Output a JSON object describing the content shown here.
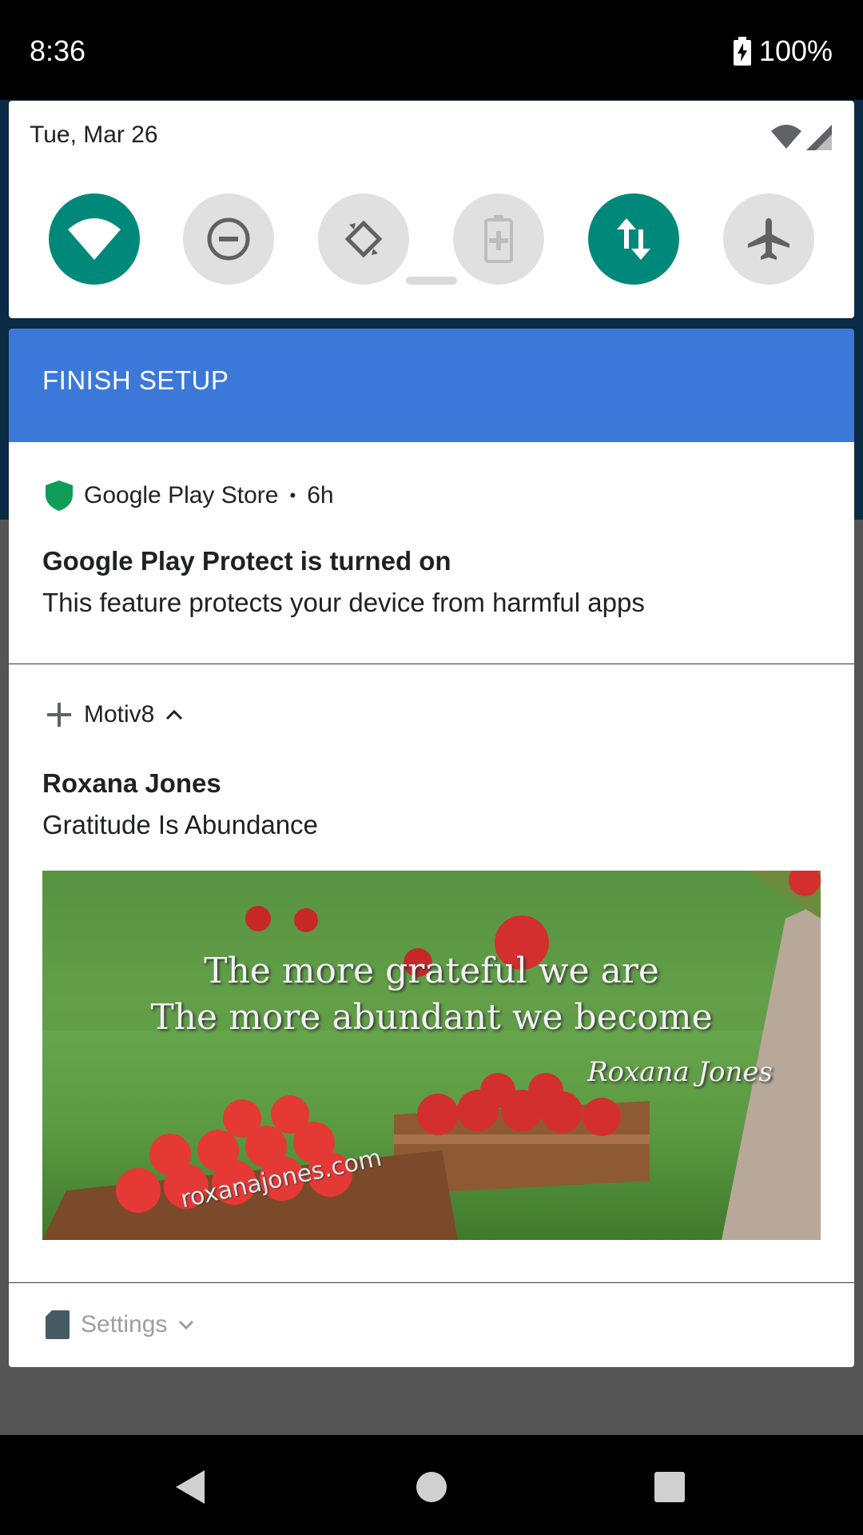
{
  "status_bar": {
    "time": "8:36",
    "battery": "100%"
  },
  "quick_settings": {
    "date": "Tue, Mar 26",
    "tiles": [
      {
        "name": "wifi",
        "icon": "wifi-icon",
        "state": "on"
      },
      {
        "name": "do-not-disturb",
        "icon": "do-not-disturb-icon",
        "state": "off"
      },
      {
        "name": "auto-rotate",
        "icon": "auto-rotate-icon",
        "state": "off"
      },
      {
        "name": "battery-saver",
        "icon": "battery-saver-icon",
        "state": "disabled"
      },
      {
        "name": "mobile-data",
        "icon": "mobile-data-icon",
        "state": "on"
      },
      {
        "name": "airplane-mode",
        "icon": "airplane-icon",
        "state": "off"
      }
    ],
    "colors": {
      "active": "#00897b",
      "inactive": "#e0e0e0"
    }
  },
  "notifications": {
    "finish_setup": {
      "title": "FINISH SETUP",
      "color": "#3c78d8"
    },
    "play_store": {
      "app": "Google Play Store",
      "separator": "•",
      "time": "6h",
      "title": "Google Play Protect is turned on",
      "text": "This feature protects your device from harmful apps",
      "icon": "shield-icon",
      "icon_color": "#0f9d58"
    },
    "motiv8": {
      "app": "Motiv8",
      "title": "Roxana Jones",
      "text": "Gratitude Is Abundance",
      "image": {
        "line1": "The more grateful we are",
        "line2": "The more abundant we become",
        "signature": "Roxana Jones",
        "watermark": "roxanajones.com"
      }
    },
    "settings": {
      "app": "Settings",
      "icon": "sd-card-icon"
    }
  },
  "nav_bar": {
    "buttons": [
      "back",
      "home",
      "recents"
    ]
  }
}
